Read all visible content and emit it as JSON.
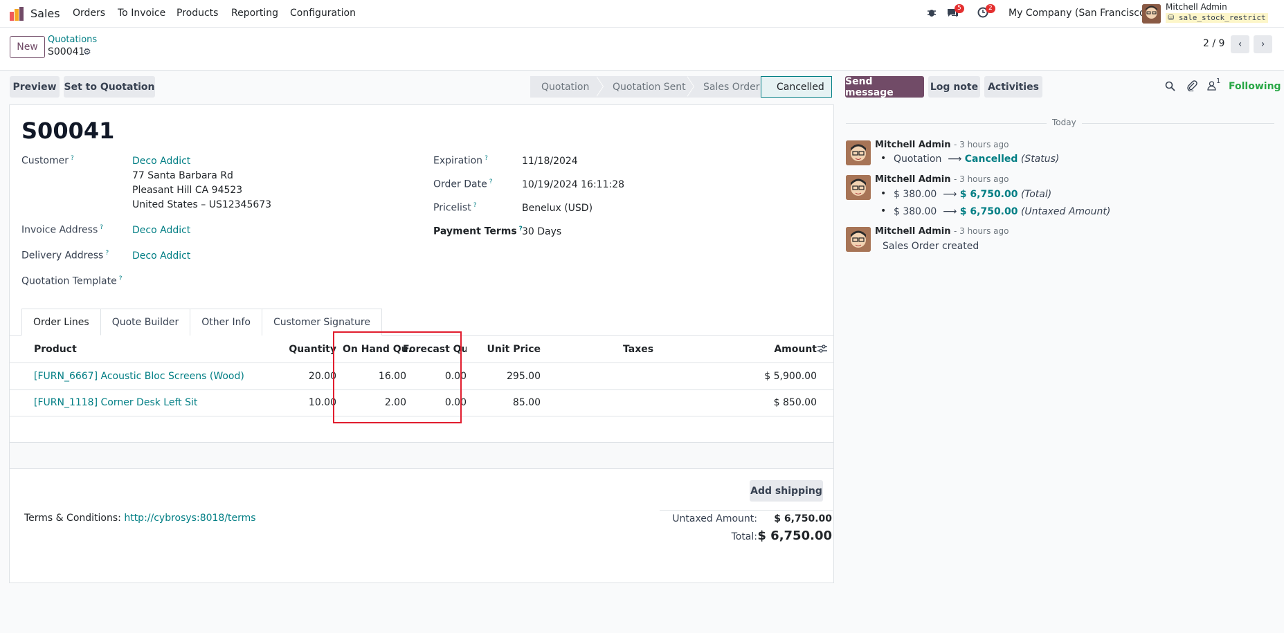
{
  "navbar": {
    "app_name": "Sales",
    "menu": [
      "Orders",
      "To Invoice",
      "Products",
      "Reporting",
      "Configuration"
    ],
    "messages_badge": "5",
    "activities_badge": "2",
    "company": "My Company (San Francisco)",
    "user_name": "Mitchell Admin",
    "database": "sale_stock_restrict"
  },
  "control_panel": {
    "new_label": "New",
    "breadcrumb_parent": "Quotations",
    "breadcrumb_current": "S00041",
    "pager": "2 / 9"
  },
  "actions": {
    "preview": "Preview",
    "set_to_quotation": "Set to Quotation"
  },
  "status_stages": [
    "Quotation",
    "Quotation Sent",
    "Sales Order",
    "Cancelled"
  ],
  "active_stage": "Cancelled",
  "form": {
    "name": "S00041",
    "customer_label": "Customer",
    "customer": "Deco Addict",
    "address_line1": "77 Santa Barbara Rd",
    "address_line2": "Pleasant Hill CA 94523",
    "address_line3": "United States – US12345673",
    "invoice_address_label": "Invoice Address",
    "invoice_address": "Deco Addict",
    "delivery_address_label": "Delivery Address",
    "delivery_address": "Deco Addict",
    "quotation_template_label": "Quotation Template",
    "expiration_label": "Expiration",
    "expiration": "11/18/2024",
    "order_date_label": "Order Date",
    "order_date": "10/19/2024 16:11:28",
    "pricelist_label": "Pricelist",
    "pricelist": "Benelux (USD)",
    "payment_terms_label": "Payment Terms",
    "payment_terms": "30 Days",
    "help_mark": "?"
  },
  "tabs": [
    "Order Lines",
    "Quote Builder",
    "Other Info",
    "Customer Signature"
  ],
  "table": {
    "headers": {
      "product": "Product",
      "quantity": "Quantity",
      "on_hand": "On Hand Qu...",
      "forecast": "Forecast Qu...",
      "unit_price": "Unit Price",
      "taxes": "Taxes",
      "amount": "Amount"
    },
    "rows": [
      {
        "product": "[FURN_6667] Acoustic Bloc Screens (Wood)",
        "quantity": "20.00",
        "on_hand": "16.00",
        "forecast": "0.00",
        "unit_price": "295.00",
        "taxes": "",
        "amount": "$ 5,900.00"
      },
      {
        "product": "[FURN_1118] Corner Desk Left Sit",
        "quantity": "10.00",
        "on_hand": "2.00",
        "forecast": "0.00",
        "unit_price": "85.00",
        "taxes": "",
        "amount": "$ 850.00"
      }
    ]
  },
  "footer": {
    "add_shipping": "Add shipping",
    "terms_label": "Terms & Conditions:",
    "terms_link": "http://cybrosys:8018/terms",
    "untaxed_label": "Untaxed Amount:",
    "untaxed_value": "$ 6,750.00",
    "total_label": "Total:",
    "total_value": "$ 6,750.00"
  },
  "chatter": {
    "send_message": "Send message",
    "log_note": "Log note",
    "activities": "Activities",
    "followers_count": "1",
    "following": "Following",
    "today": "Today",
    "messages": [
      {
        "author": "Mitchell Admin",
        "time": "- 3 hours ago",
        "changes": [
          {
            "old": "Quotation",
            "new": "Cancelled",
            "field": "(Status)"
          }
        ]
      },
      {
        "author": "Mitchell Admin",
        "time": "- 3 hours ago",
        "changes": [
          {
            "old": "$ 380.00",
            "new": "$ 6,750.00",
            "field": "(Total)"
          },
          {
            "old": "$ 380.00",
            "new": "$ 6,750.00",
            "field": "(Untaxed Amount)"
          }
        ]
      },
      {
        "author": "Mitchell Admin",
        "time": "- 3 hours ago",
        "body": "Sales Order created"
      }
    ]
  },
  "colors": {
    "brand": "#714b67",
    "link": "#017e84",
    "highlight": "#e11d2e"
  }
}
